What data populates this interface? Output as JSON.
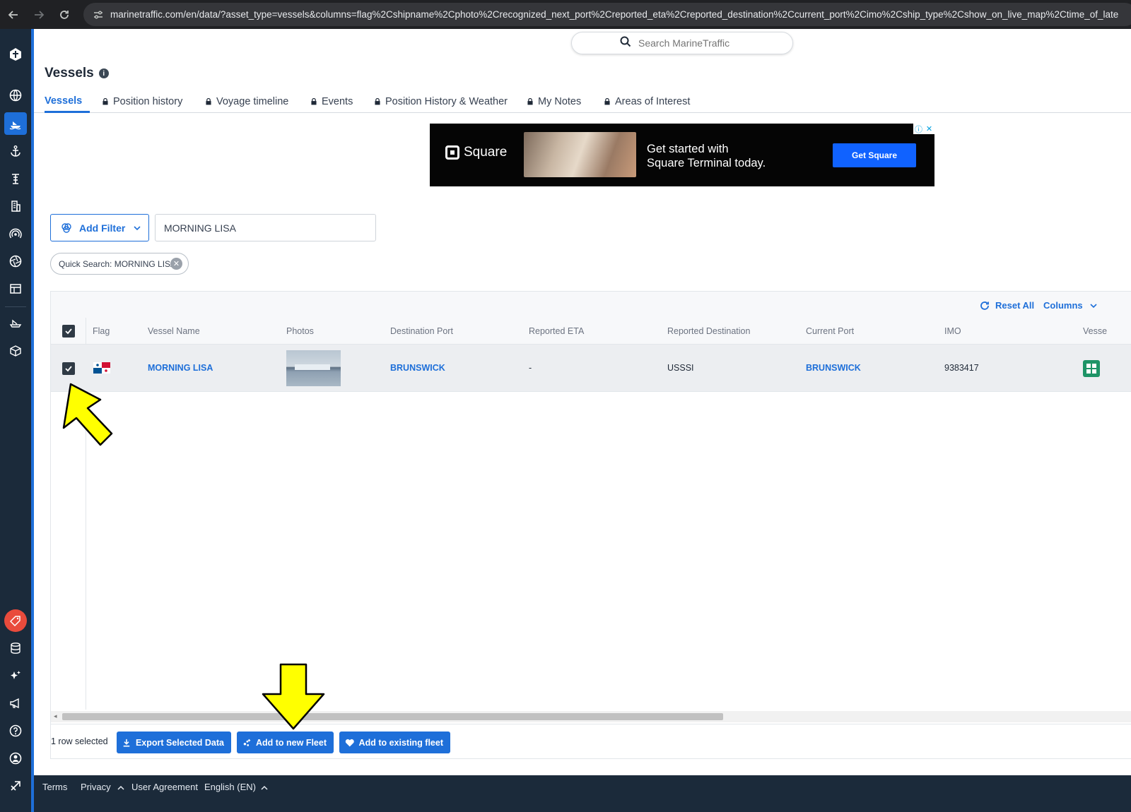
{
  "browser": {
    "url": "marinetraffic.com/en/data/?asset_type=vessels&columns=flag%2Cshipname%2Cphoto%2Crecognized_next_port%2Creported_eta%2Creported_destination%2Ccurrent_port%2Cimo%2Cship_type%2Cshow_on_live_map%2Ctime_of_late"
  },
  "search": {
    "placeholder": "Search MarineTraffic"
  },
  "page": {
    "title": "Vessels",
    "info": "i"
  },
  "tabs": [
    {
      "label": "Vessels"
    },
    {
      "label": "Position history"
    },
    {
      "label": "Voyage timeline"
    },
    {
      "label": "Events"
    },
    {
      "label": "Position History & Weather"
    },
    {
      "label": "My Notes"
    },
    {
      "label": "Areas of Interest"
    }
  ],
  "ad": {
    "brand": "Square",
    "headline_line1": "Get started with",
    "headline_line2": "Square Terminal today.",
    "cta": "Get Square"
  },
  "filters": {
    "add_filter_label": "Add Filter",
    "query_value": "MORNING LISA",
    "chip_label": "Quick Search: MORNING LISA"
  },
  "grid": {
    "toolbar": {
      "reset_label": "Reset All",
      "columns_label": "Columns"
    },
    "columns": [
      "Flag",
      "Vessel Name",
      "Photos",
      "Destination Port",
      "Reported ETA",
      "Reported Destination",
      "Current Port",
      "IMO",
      "Vesse"
    ],
    "rows": [
      {
        "vessel_name": "MORNING LISA",
        "destination_port": "BRUNSWICK",
        "reported_eta": "-",
        "reported_destination": "USSSI",
        "current_port": "BRUNSWICK",
        "imo": "9383417"
      }
    ],
    "footer": {
      "selected_text": "1 row selected",
      "export_label": "Export Selected Data",
      "add_new_fleet_label": "Add to new Fleet",
      "add_existing_fleet_label": "Add to existing fleet"
    }
  },
  "footer": {
    "terms": "Terms",
    "privacy": "Privacy",
    "user_agreement": "User Agreement",
    "language": "English (EN)"
  },
  "colors": {
    "accent": "#1e6fd9",
    "rail": "#1b2a3a",
    "annotation_arrow": "#ffff00"
  }
}
